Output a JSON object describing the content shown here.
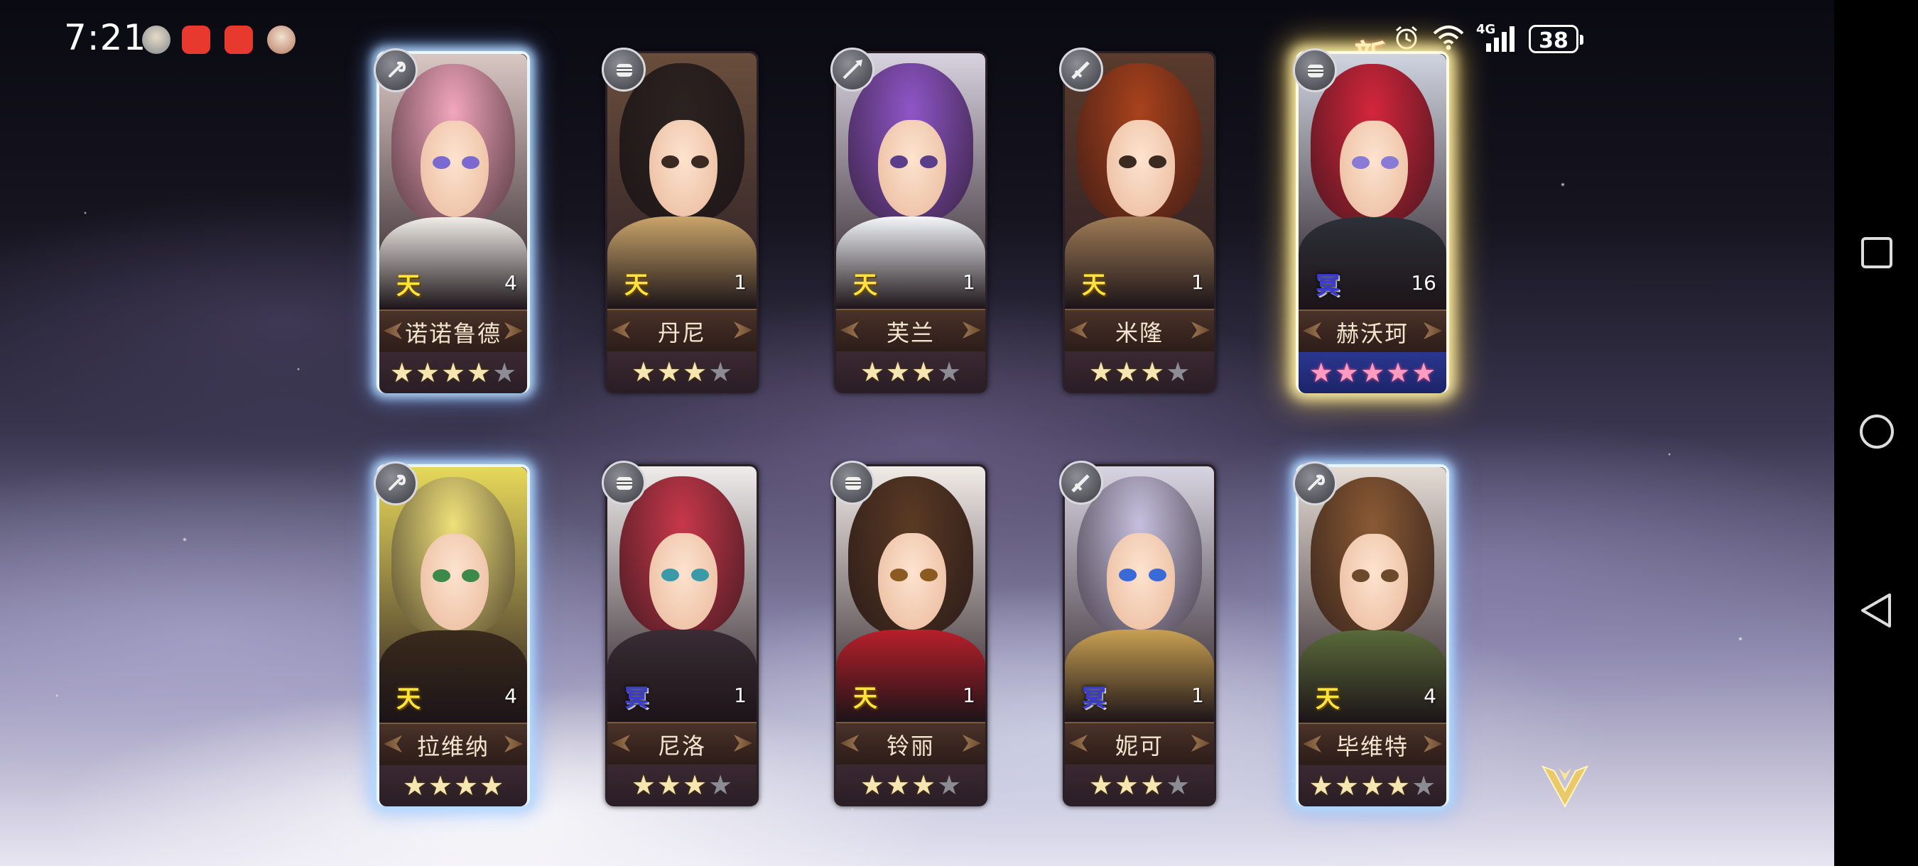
{
  "status_bar": {
    "time": "7:21",
    "battery": "38",
    "network": "4G",
    "notification_icons": [
      "avatar-notification-icon",
      "huawei-appgallery-icon",
      "huawei-appgallery-icon",
      "avatar-notification-icon"
    ]
  },
  "new_badge": "新",
  "cards": [
    {
      "name": "诺诺鲁德",
      "element": "天",
      "count": "4",
      "stars": 4,
      "max_stars": 5,
      "frame": "blue",
      "role_icon": "staff-icon"
    },
    {
      "name": "丹尼",
      "element": "天",
      "count": "1",
      "stars": 3,
      "max_stars": 4,
      "frame": "plain",
      "role_icon": "fist-icon"
    },
    {
      "name": "芙兰",
      "element": "天",
      "count": "1",
      "stars": 3,
      "max_stars": 4,
      "frame": "plain",
      "role_icon": "spear-icon"
    },
    {
      "name": "米隆",
      "element": "天",
      "count": "1",
      "stars": 3,
      "max_stars": 4,
      "frame": "plain",
      "role_icon": "sword-icon"
    },
    {
      "name": "赫沃珂",
      "element": "冥",
      "count": "16",
      "stars": 5,
      "max_stars": 5,
      "frame": "gold",
      "role_icon": "fist-icon",
      "star_color": "pink"
    },
    {
      "name": "拉维纳",
      "element": "天",
      "count": "4",
      "stars": 4,
      "max_stars": 4,
      "frame": "blue",
      "role_icon": "staff-icon"
    },
    {
      "name": "尼洛",
      "element": "冥",
      "count": "1",
      "stars": 3,
      "max_stars": 4,
      "frame": "plain",
      "role_icon": "fist-icon"
    },
    {
      "name": "铃丽",
      "element": "天",
      "count": "1",
      "stars": 3,
      "max_stars": 4,
      "frame": "plain",
      "role_icon": "fist-icon"
    },
    {
      "name": "妮可",
      "element": "冥",
      "count": "1",
      "stars": 3,
      "max_stars": 4,
      "frame": "plain",
      "role_icon": "sword-icon"
    },
    {
      "name": "毕维特",
      "element": "天",
      "count": "4",
      "stars": 4,
      "max_stars": 5,
      "frame": "blue",
      "role_icon": "staff-icon"
    }
  ],
  "nav": {
    "recent_apps": "square-icon",
    "home": "circle-icon",
    "back": "triangle-back-icon"
  },
  "colors": {
    "tian_element": "#ffe23a",
    "ming_element": "#3a3ad8",
    "name_text": "#f3e6cf"
  }
}
